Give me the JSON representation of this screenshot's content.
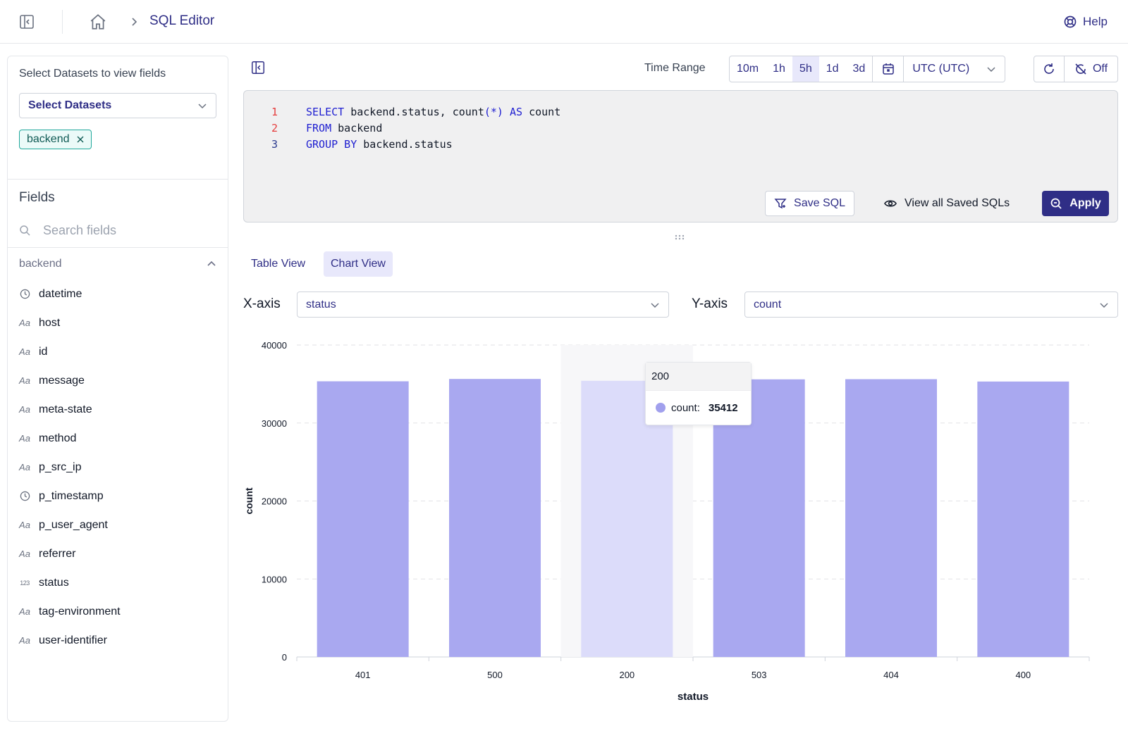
{
  "topbar": {
    "breadcrumb": "SQL Editor",
    "help_label": "Help"
  },
  "sidebar": {
    "datasets_label": "Select Datasets to view fields",
    "datasets_placeholder": "Select Datasets",
    "selected_tag": "backend",
    "fields_title": "Fields",
    "search_placeholder": "Search fields",
    "group_name": "backend",
    "fields": [
      {
        "name": "datetime",
        "icon": "clock-icon"
      },
      {
        "name": "host",
        "icon": "text-type-icon"
      },
      {
        "name": "id",
        "icon": "text-type-icon"
      },
      {
        "name": "message",
        "icon": "text-type-icon"
      },
      {
        "name": "meta-state",
        "icon": "text-type-icon"
      },
      {
        "name": "method",
        "icon": "text-type-icon"
      },
      {
        "name": "p_src_ip",
        "icon": "text-type-icon"
      },
      {
        "name": "p_timestamp",
        "icon": "clock-icon"
      },
      {
        "name": "p_user_agent",
        "icon": "text-type-icon"
      },
      {
        "name": "referrer",
        "icon": "text-type-icon"
      },
      {
        "name": "status",
        "icon": "number-type-icon"
      },
      {
        "name": "tag-environment",
        "icon": "text-type-icon"
      },
      {
        "name": "user-identifier",
        "icon": "text-type-icon"
      }
    ]
  },
  "toolbar": {
    "time_range_label": "Time Range",
    "time_options": [
      "10m",
      "1h",
      "5h",
      "1d",
      "3d"
    ],
    "active_time": "5h",
    "timezone": "UTC (UTC)",
    "auto_refresh": "Off"
  },
  "editor": {
    "lines": [
      {
        "n": "1",
        "tokens": [
          {
            "t": "SELECT",
            "k": true
          },
          {
            "t": " backend.status, count",
            "k": false
          },
          {
            "t": "(*)",
            "k": true
          },
          {
            "t": " ",
            "k": false
          },
          {
            "t": "AS",
            "k": true
          },
          {
            "t": " count",
            "k": false
          }
        ]
      },
      {
        "n": "2",
        "tokens": [
          {
            "t": "FROM",
            "k": true
          },
          {
            "t": " backend",
            "k": false
          }
        ]
      },
      {
        "n": "3",
        "tokens": [
          {
            "t": "GROUP BY",
            "k": true
          },
          {
            "t": " backend.status",
            "k": false
          }
        ]
      }
    ],
    "save_label": "Save SQL",
    "view_saved_label": "View all Saved SQLs",
    "apply_label": "Apply"
  },
  "tabs": [
    "Table View",
    "Chart View"
  ],
  "active_tab": "Chart View",
  "axes": {
    "x_label": "X-axis",
    "x_value": "status",
    "y_label": "Y-axis",
    "y_value": "count"
  },
  "tooltip": {
    "header": "200",
    "series": "count:",
    "value": "35412"
  },
  "colors": {
    "bar": "#a9a8f0",
    "bar_highlight": "#dcdcfa",
    "accent": "#2f2e86"
  },
  "chart_data": {
    "type": "bar",
    "categories": [
      "401",
      "500",
      "200",
      "503",
      "404",
      "400"
    ],
    "values": [
      35350,
      35650,
      35412,
      35600,
      35620,
      35320
    ],
    "highlighted": "200",
    "xlabel": "status",
    "ylabel": "count",
    "ylim": [
      0,
      40000
    ],
    "yticks": [
      "0",
      "10000",
      "20000",
      "30000",
      "40000"
    ],
    "grid": true
  }
}
